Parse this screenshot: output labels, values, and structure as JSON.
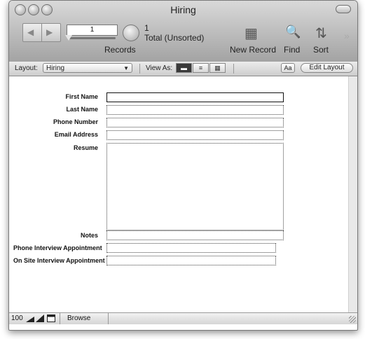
{
  "window": {
    "title": "Hiring"
  },
  "toolbar": {
    "record_number": "1",
    "records_label": "Records",
    "found_count": "1",
    "total_label": "Total (Unsorted)",
    "new_record_label": "New Record",
    "find_label": "Find",
    "sort_label": "Sort",
    "prev_icon": "◀",
    "next_icon": "▶",
    "new_record_icon": "▦",
    "find_icon": "🔍",
    "sort_icon": "⇅",
    "overflow_icon": "»"
  },
  "layout_bar": {
    "layout_label": "Layout:",
    "layout_value": "Hiring",
    "view_as_label": "View As:",
    "font_button": "Aa",
    "edit_layout_label": "Edit Layout"
  },
  "form": {
    "labels": {
      "first_name": "First Name",
      "last_name": "Last Name",
      "phone": "Phone Number",
      "email": "Email Address",
      "resume": "Resume",
      "notes": "Notes",
      "phone_interview": "Phone Interview Appointment",
      "onsite_interview": "On Site Interview Appointment"
    }
  },
  "bottom_bar": {
    "zoom": "100",
    "mode": "Browse"
  }
}
